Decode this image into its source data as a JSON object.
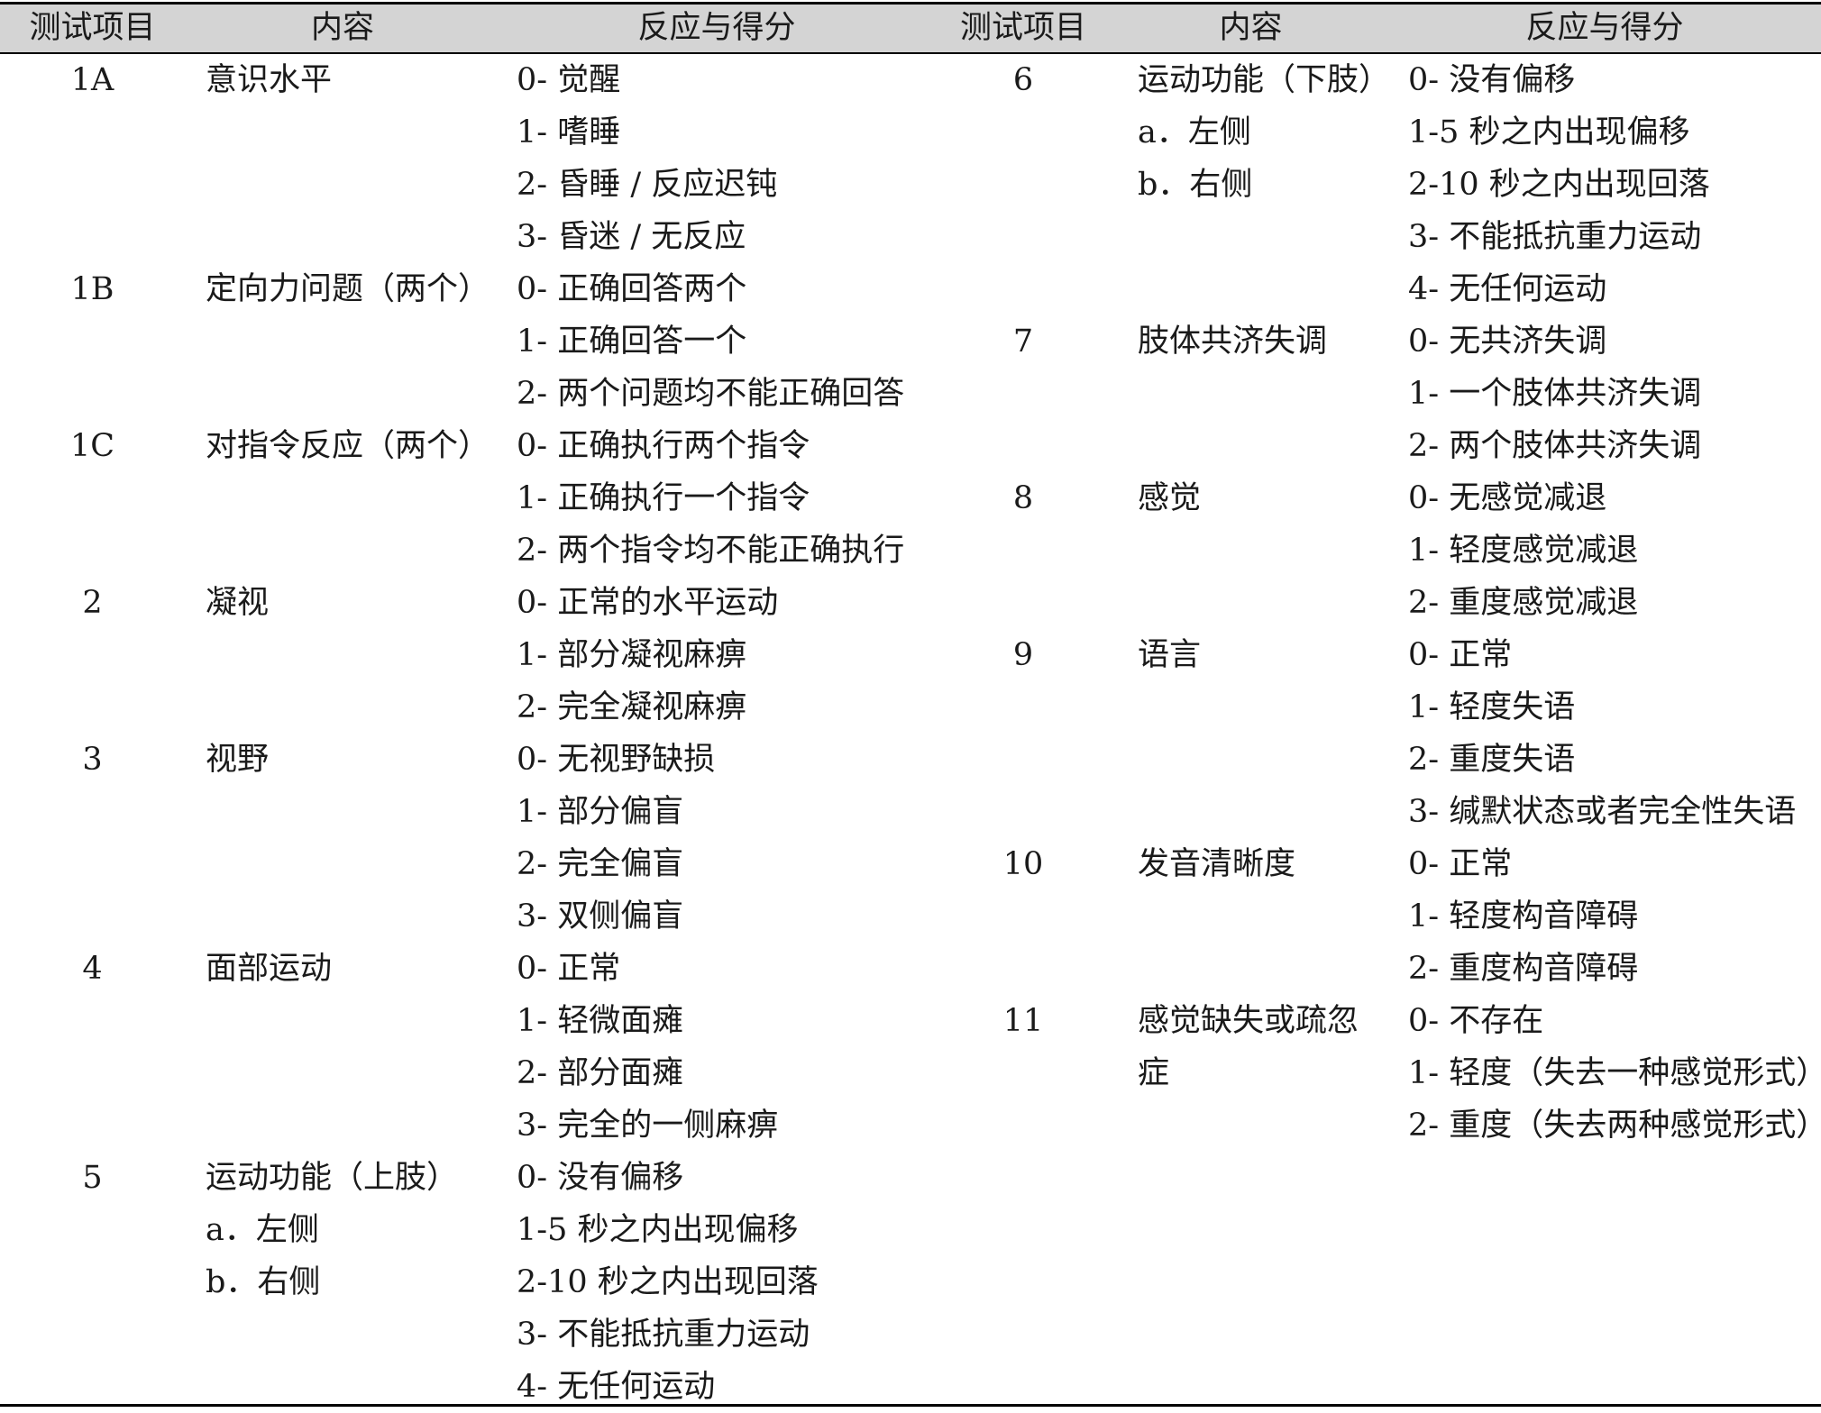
{
  "headers": [
    "测试项目",
    "内容",
    "反应与得分",
    "测试项目",
    "内容",
    "反应与得分"
  ],
  "left": {
    "items": [
      "1A",
      "",
      "",
      "",
      "1B",
      "",
      "",
      "1C",
      "",
      "",
      "2",
      "",
      "",
      "3",
      "",
      "",
      "",
      "4",
      "",
      "",
      "",
      "5",
      "",
      "",
      "",
      ""
    ],
    "contents": [
      "意识水平",
      "",
      "",
      "",
      "定向力问题（两个）",
      "",
      "",
      "对指令反应（两个）",
      "",
      "",
      "凝视",
      "",
      "",
      "视野",
      "",
      "",
      "",
      "面部运动",
      "",
      "",
      "",
      "运动功能（上肢）",
      "a．左侧",
      "b．右侧",
      "",
      ""
    ],
    "scores": [
      "0- 觉醒",
      "1- 嗜睡",
      "2- 昏睡 / 反应迟钝",
      "3- 昏迷 / 无反应",
      "0- 正确回答两个",
      "1- 正确回答一个",
      "2- 两个问题均不能正确回答",
      "0- 正确执行两个指令",
      "1- 正确执行一个指令",
      "2- 两个指令均不能正确执行",
      "0- 正常的水平运动",
      "1- 部分凝视麻痹",
      "2- 完全凝视麻痹",
      "0- 无视野缺损",
      "1- 部分偏盲",
      "2- 完全偏盲",
      "3- 双侧偏盲",
      "0- 正常",
      "1- 轻微面瘫",
      "2- 部分面瘫",
      "3- 完全的一侧麻痹",
      "0- 没有偏移",
      "1-5 秒之内出现偏移",
      "2-10 秒之内出现回落",
      "3- 不能抵抗重力运动",
      "4- 无任何运动"
    ]
  },
  "right": {
    "items": [
      "6",
      "",
      "",
      "",
      "",
      "7",
      "",
      "",
      "8",
      "",
      "",
      "9",
      "",
      "",
      "",
      "10",
      "",
      "",
      "11",
      "",
      ""
    ],
    "contents": [
      "运动功能（下肢）",
      "a．左侧",
      "b．右侧",
      "",
      "",
      "肢体共济失调",
      "",
      "",
      "感觉",
      "",
      "",
      "语言",
      "",
      "",
      "",
      "发音清晰度",
      "",
      "",
      "感觉缺失或疏忽",
      "症",
      ""
    ],
    "scores": [
      "0- 没有偏移",
      "1-5 秒之内出现偏移",
      "2-10 秒之内出现回落",
      "3- 不能抵抗重力运动",
      "4- 无任何运动",
      "0- 无共济失调",
      "1- 一个肢体共济失调",
      "2- 两个肢体共济失调",
      "0- 无感觉减退",
      "1- 轻度感觉减退",
      "2- 重度感觉减退",
      "0- 正常",
      "1- 轻度失语",
      "2- 重度失语",
      "3- 缄默状态或者完全性失语",
      "0- 正常",
      "1- 轻度构音障碍",
      "2- 重度构音障碍",
      "0- 不存在",
      "1- 轻度（失去一种感觉形式）",
      "2- 重度（失去两种感觉形式）"
    ]
  }
}
